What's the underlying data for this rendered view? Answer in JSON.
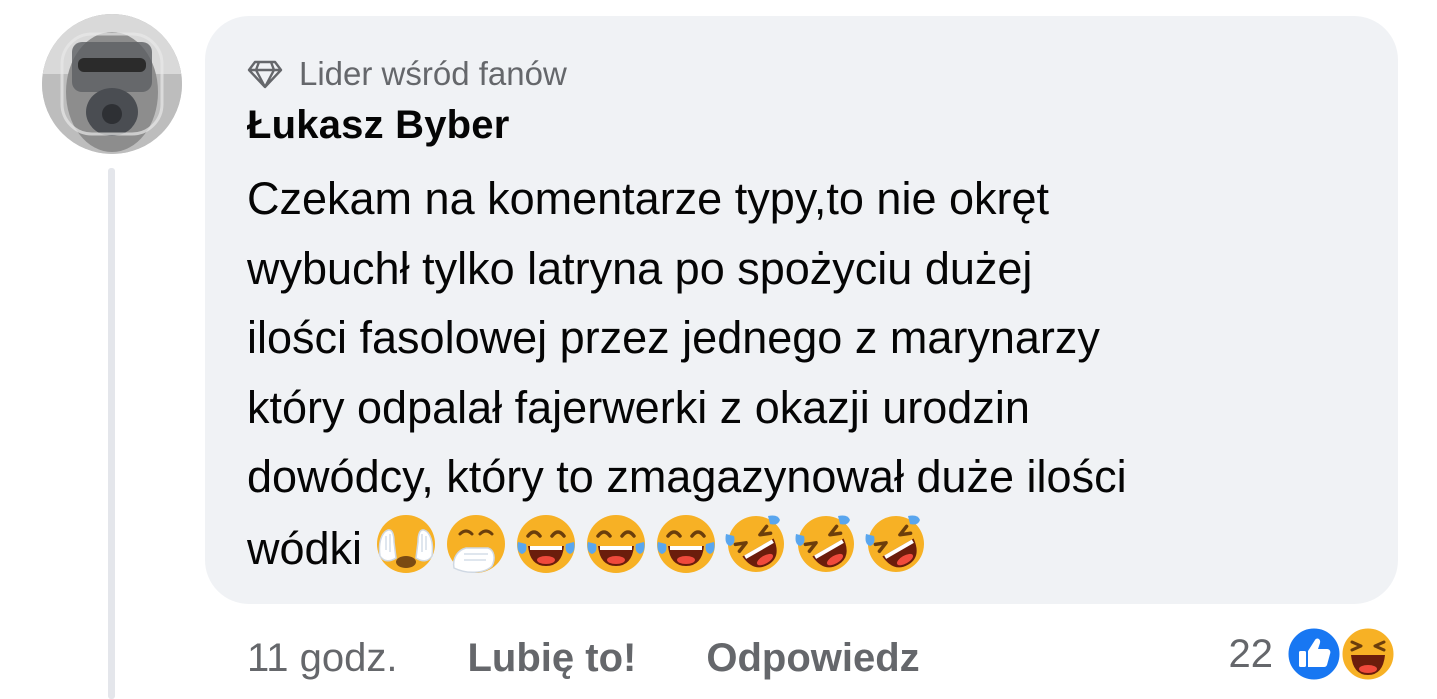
{
  "comment": {
    "badge_label": "Lider wśród fanów",
    "author": "Łukasz Byber",
    "text_lines": [
      "Czekam na komentarze typy,to nie okręt",
      "wybuchł tylko latryna po spożyciu dużej",
      "ilości fasolowej przez jednego z marynarzy",
      "który odpalał fajerwerki z okazji urodzin",
      "dowódcy, który to zmagazynował duże ilości",
      "wódki"
    ],
    "emojis": [
      "face-with-hands-over-eyes-emoji",
      "hand-over-mouth-emoji",
      "tears-of-joy-emoji",
      "tears-of-joy-emoji",
      "tears-of-joy-emoji",
      "rolling-on-floor-laughing-emoji",
      "rolling-on-floor-laughing-emoji",
      "rolling-on-floor-laughing-emoji"
    ]
  },
  "actions": {
    "time": "11 godz.",
    "like_label": "Lubię to!",
    "reply_label": "Odpowiedz"
  },
  "reactions": {
    "count": "22",
    "icons": [
      "like-reaction-icon",
      "haha-reaction-icon"
    ]
  },
  "colors": {
    "bubble_bg": "#f0f2f5",
    "text": "#050505",
    "secondary": "#65676b",
    "like_blue": "#1877f2",
    "emoji_yellow": "#f7b125"
  }
}
